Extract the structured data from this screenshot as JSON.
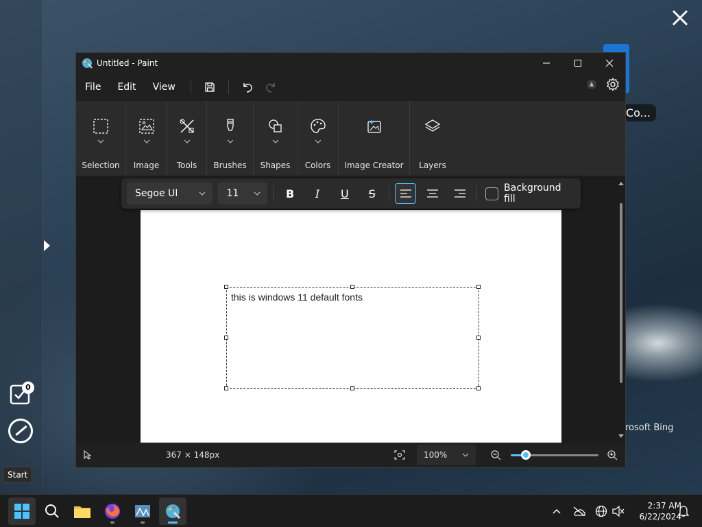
{
  "desktop": {
    "badge_count": "0",
    "copilot_text": "Co...",
    "bing_text": "rosoft Bing",
    "start_tooltip": "Start"
  },
  "window": {
    "title": "Untitled - Paint"
  },
  "menu": {
    "file": "File",
    "edit": "Edit",
    "view": "View"
  },
  "ribbon": {
    "groups": [
      {
        "label": "Selection",
        "icon": "selection-icon"
      },
      {
        "label": "Image",
        "icon": "image-icon"
      },
      {
        "label": "Tools",
        "icon": "tools-icon"
      },
      {
        "label": "Brushes",
        "icon": "brush-icon"
      },
      {
        "label": "Shapes",
        "icon": "shapes-icon"
      },
      {
        "label": "Colors",
        "icon": "palette-icon"
      },
      {
        "label": "Image Creator",
        "icon": "image-creator-icon"
      },
      {
        "label": "Layers",
        "icon": "layers-icon"
      }
    ]
  },
  "textbar": {
    "font": "Segoe UI",
    "size": "11",
    "background_fill": "Background fill",
    "bold_glyph": "B",
    "italic_glyph": "I",
    "underline_glyph": "U",
    "strike_glyph": "S"
  },
  "canvas": {
    "text": "this is windows 11 default fonts"
  },
  "status": {
    "dimensions": "367 × 148px",
    "zoom": "100%",
    "zoom_level": 0.17
  },
  "taskbar": {
    "time": "2:37 AM",
    "date": "6/22/2024"
  },
  "colors": {
    "accent": "#4cc2ff",
    "window_bg": "#202020",
    "ribbon_bg": "#2b2b2b"
  }
}
